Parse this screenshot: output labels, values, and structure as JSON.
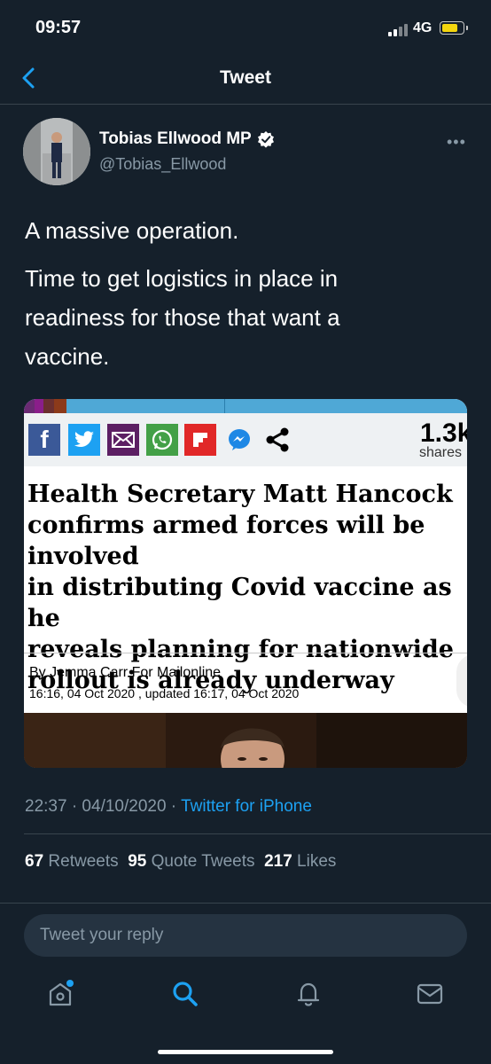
{
  "status": {
    "time": "09:57",
    "network": "4G"
  },
  "nav": {
    "title": "Tweet"
  },
  "author": {
    "name": "Tobias Ellwood MP",
    "handle": "@Tobias_Ellwood",
    "verified": true
  },
  "tweet": {
    "line1": "A massive operation.",
    "line2": "Time to get logistics in place in",
    "line3": "readiness for those that want a",
    "line4": "vaccine."
  },
  "card": {
    "share_count": "1.3k",
    "share_label": "shares",
    "headline": "Health Secretary Matt Hancock\nconfirms armed forces will be involved\nin distributing Covid vaccine as he\nreveals planning for nationwide\nrollout is already underway",
    "byline": "By Jemma Carr For Mailonline",
    "dateline": "16:16, 04 Oct 2020 , updated 16:17, 04 Oct 2020",
    "share_icons": [
      "facebook-icon",
      "twitter-icon",
      "email-icon",
      "whatsapp-icon",
      "flipboard-icon",
      "messenger-icon",
      "share-icon"
    ]
  },
  "meta": {
    "time": "22:37 · 04/10/2020 · ",
    "source": "Twitter for iPhone"
  },
  "stats": {
    "retweets_count": "67",
    "retweets_label": "Retweets",
    "quotes_count": "95",
    "quotes_label": "Quote Tweets",
    "likes_count": "217",
    "likes_label": "Likes"
  },
  "reply": {
    "placeholder": "Tweet your reply"
  },
  "tabs": [
    "home-icon",
    "search-icon",
    "notifications-icon",
    "messages-icon"
  ],
  "colors": {
    "background": "#15202b",
    "accent": "#1da1f2",
    "secondary_text": "#8899a6",
    "divider": "#38444d"
  }
}
